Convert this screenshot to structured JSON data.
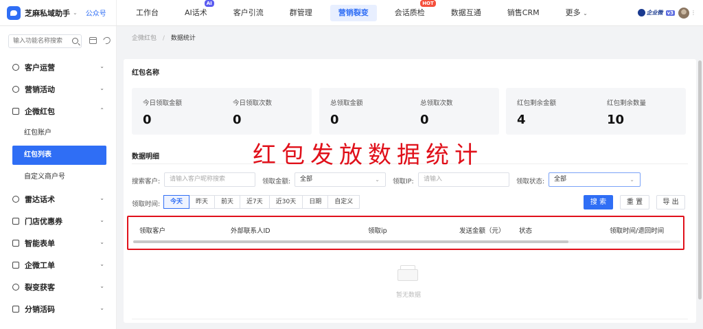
{
  "brand": {
    "name": "芝麻私域助手",
    "caret": "⌄",
    "account_type": "公众号"
  },
  "nav": {
    "items": [
      {
        "label": "工作台"
      },
      {
        "label": "AI话术",
        "badge": "AI"
      },
      {
        "label": "客户引流"
      },
      {
        "label": "群管理"
      },
      {
        "label": "营销裂变",
        "active": true
      },
      {
        "label": "会话质检",
        "badge": "HOT"
      },
      {
        "label": "数据互通"
      },
      {
        "label": "销售CRM"
      }
    ],
    "more": "更多",
    "more_caret": "⌄",
    "corp_wechat": "企业微",
    "version": "v3"
  },
  "sidebar": {
    "search_placeholder": "输入功能名称搜索",
    "menu": [
      {
        "label": "客户运营",
        "caret": "⌄"
      },
      {
        "label": "营销活动",
        "caret": "⌄"
      },
      {
        "label": "企微红包",
        "caret": "⌃"
      },
      {
        "label": "雷达话术",
        "caret": "⌄"
      },
      {
        "label": "门店优惠券",
        "caret": "⌄"
      },
      {
        "label": "智能表单",
        "caret": "⌄"
      },
      {
        "label": "企微工单",
        "caret": "⌄"
      },
      {
        "label": "裂变获客",
        "caret": "⌄"
      },
      {
        "label": "分销活码",
        "caret": "⌄"
      }
    ],
    "submenu": [
      "红包账户",
      "红包列表",
      "自定义商户号"
    ]
  },
  "breadcrumb": {
    "parent": "企微红包",
    "separator": "/",
    "current": "数据统计"
  },
  "panel": {
    "title": "红包名称",
    "stats": [
      {
        "label": "今日领取金额",
        "value": "0"
      },
      {
        "label": "今日领取次数",
        "value": "0"
      },
      {
        "label": "总领取金额",
        "value": "0"
      },
      {
        "label": "总领取次数",
        "value": "0"
      },
      {
        "label": "红包剩余金额",
        "value": "4"
      },
      {
        "label": "红包剩余数量",
        "value": "10"
      }
    ],
    "detail_title": "数据明细",
    "overlay_title": "红包发放数据统计"
  },
  "filters": {
    "customer_label": "搜索客户:",
    "customer_placeholder": "请输入客户昵称搜索",
    "amount_label": "领取金额:",
    "amount_value": "全部",
    "ip_label": "领取IP:",
    "ip_placeholder": "请输入",
    "status_label": "领取状态:",
    "status_value": "全部",
    "time_label": "领取时间:",
    "time_options": [
      "今天",
      "昨天",
      "前天",
      "近7天",
      "近30天",
      "日期",
      "自定义"
    ],
    "search_button": "搜 索",
    "reset_button": "重 置",
    "export_button": "导 出",
    "caret": "⌄"
  },
  "table": {
    "columns": [
      "领取客户",
      "外部联系人ID",
      "领取ip",
      "发送金额（元）",
      "状态",
      "领取时间/退回时间"
    ],
    "empty_text": "暂无数据"
  }
}
